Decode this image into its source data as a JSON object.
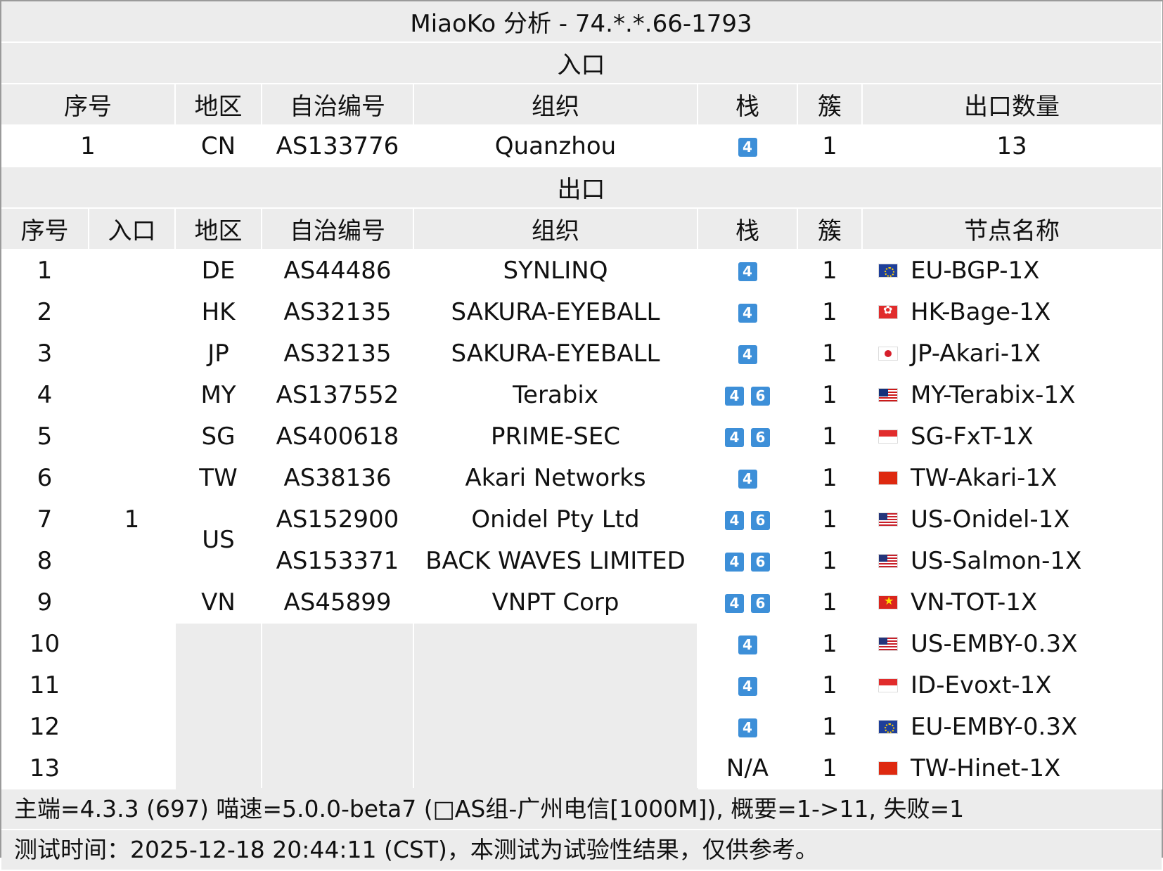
{
  "title": "MiaoKo 分析 - 74.*.*.66-1793",
  "entry": {
    "section_label": "入口",
    "headers": [
      "序号",
      "地区",
      "自治编号",
      "组织",
      "栈",
      "簇",
      "出口数量"
    ],
    "row": {
      "index": "1",
      "region": "CN",
      "asn": "AS133776",
      "org": "Quanzhou",
      "stack": [
        "4"
      ],
      "cluster": "1",
      "exit_count": "13"
    }
  },
  "exit": {
    "section_label": "出口",
    "headers": [
      "序号",
      "入口",
      "地区",
      "自治编号",
      "组织",
      "栈",
      "簇",
      "节点名称"
    ],
    "entry_value": "1",
    "rows": [
      {
        "index": "1",
        "region": "DE",
        "asn": "AS44486",
        "org": "SYNLINQ",
        "stack": [
          "4"
        ],
        "stack_text": "",
        "cluster": "1",
        "flag": "eu-flag-icon",
        "node": "EU-BGP-1X"
      },
      {
        "index": "2",
        "region": "HK",
        "asn": "AS32135",
        "org": "SAKURA-EYEBALL",
        "stack": [
          "4"
        ],
        "stack_text": "",
        "cluster": "1",
        "flag": "hk-flag-icon",
        "node": "HK-Bage-1X"
      },
      {
        "index": "3",
        "region": "JP",
        "asn": "AS32135",
        "org": "SAKURA-EYEBALL",
        "stack": [
          "4"
        ],
        "stack_text": "",
        "cluster": "1",
        "flag": "jp-flag-icon",
        "node": "JP-Akari-1X"
      },
      {
        "index": "4",
        "region": "MY",
        "asn": "AS137552",
        "org": "Terabix",
        "stack": [
          "4",
          "6"
        ],
        "stack_text": "",
        "cluster": "1",
        "flag": "my-flag-icon",
        "node": "MY-Terabix-1X"
      },
      {
        "index": "5",
        "region": "SG",
        "asn": "AS400618",
        "org": "PRIME-SEC",
        "stack": [
          "4",
          "6"
        ],
        "stack_text": "",
        "cluster": "1",
        "flag": "sg-flag-icon",
        "node": "SG-FxT-1X"
      },
      {
        "index": "6",
        "region": "TW",
        "asn": "AS38136",
        "org": "Akari Networks",
        "stack": [
          "4"
        ],
        "stack_text": "",
        "cluster": "1",
        "flag": "cn-flag-icon",
        "node": "TW-Akari-1X"
      },
      {
        "index": "7",
        "region": "US",
        "asn": "AS152900",
        "org": "Onidel Pty Ltd",
        "stack": [
          "4",
          "6"
        ],
        "stack_text": "",
        "cluster": "1",
        "flag": "us-flag-icon",
        "node": "US-Onidel-1X"
      },
      {
        "index": "8",
        "region": "",
        "asn": "AS153371",
        "org": "BACK WAVES LIMITED",
        "stack": [
          "4",
          "6"
        ],
        "stack_text": "",
        "cluster": "1",
        "flag": "us-flag-icon",
        "node": "US-Salmon-1X"
      },
      {
        "index": "9",
        "region": "VN",
        "asn": "AS45899",
        "org": "VNPT Corp",
        "stack": [
          "4",
          "6"
        ],
        "stack_text": "",
        "cluster": "1",
        "flag": "vn-flag-icon",
        "node": "VN-TOT-1X"
      },
      {
        "index": "10",
        "region": "",
        "asn": "",
        "org": "",
        "stack": [
          "4"
        ],
        "stack_text": "",
        "cluster": "1",
        "flag": "us-flag-icon",
        "node": "US-EMBY-0.3X"
      },
      {
        "index": "11",
        "region": "",
        "asn": "",
        "org": "",
        "stack": [
          "4"
        ],
        "stack_text": "",
        "cluster": "1",
        "flag": "id-flag-icon",
        "node": "ID-Evoxt-1X"
      },
      {
        "index": "12",
        "region": "",
        "asn": "",
        "org": "",
        "stack": [
          "4"
        ],
        "stack_text": "",
        "cluster": "1",
        "flag": "eu-flag-icon",
        "node": "EU-EMBY-0.3X"
      },
      {
        "index": "13",
        "region": "",
        "asn": "",
        "org": "",
        "stack": [],
        "stack_text": "N/A",
        "cluster": "1",
        "flag": "cn-flag-icon",
        "node": "TW-Hinet-1X"
      }
    ]
  },
  "footer": {
    "line1": "主端=4.3.3 (697) 喵速=5.0.0-beta7 (□AS组-广州电信[1000M]), 概要=1->11, 失败=1",
    "line2": "测试时间：2025-12-18 20:44:11 (CST)，本测试为试验性结果，仅供参考。"
  },
  "colors": {
    "badge": "#3d8fd8",
    "band": "#ececec",
    "border": "#9a9a9a"
  }
}
